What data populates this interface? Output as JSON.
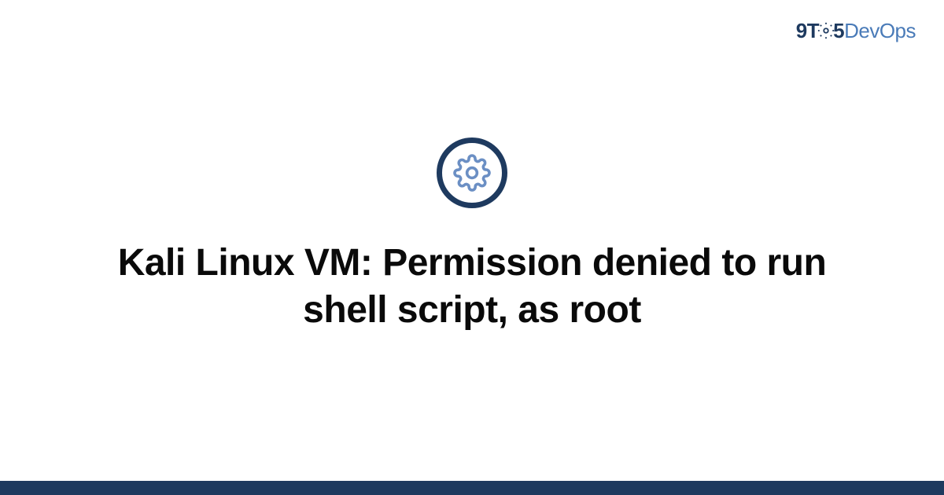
{
  "logo": {
    "part1": "9T",
    "part2": "5",
    "part3": "DevOps"
  },
  "main": {
    "title": "Kali Linux VM: Permission denied to run shell script, as root"
  },
  "colors": {
    "dark_blue": "#1e3a5f",
    "light_blue": "#4a7bb8",
    "gear_blue": "#6b8fc4"
  }
}
